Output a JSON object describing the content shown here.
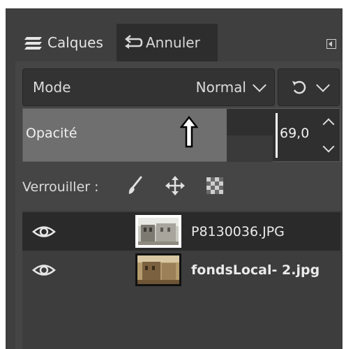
{
  "tabs": [
    {
      "label": "Calques",
      "icon": "layers-icon"
    },
    {
      "label": "Annuler",
      "icon": "undo-icon"
    }
  ],
  "mode": {
    "label": "Mode",
    "value": "Normal"
  },
  "opacity": {
    "label": "Opacité",
    "value": "69,0",
    "level_percent": 69
  },
  "lock": {
    "label": "Verrouiller :",
    "icons": [
      "paintbrush-icon",
      "move-icon",
      "checkerboard-icon"
    ]
  },
  "layers": [
    {
      "name": "P8130036.JPG",
      "visible": true,
      "selected": true
    },
    {
      "name": "fondsLocal- 2.jpg",
      "visible": true,
      "selected": false,
      "bold": true
    }
  ],
  "colors": {
    "panel": "#454545",
    "selected_row": "#2a2a2a",
    "slider_fill": "#6f6f6f"
  }
}
